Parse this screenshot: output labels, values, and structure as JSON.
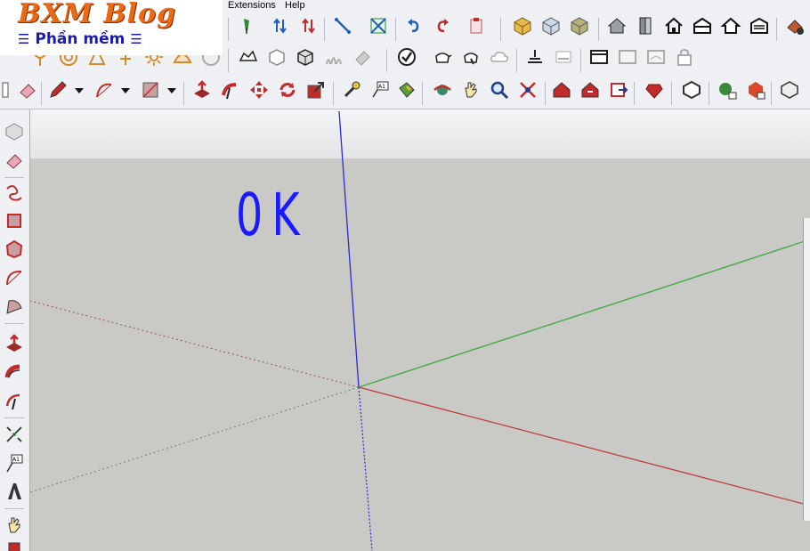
{
  "menu": {
    "items": [
      "Extensions",
      "Help"
    ]
  },
  "logo": {
    "title": "BXM Blog",
    "subtitle": "Phần mềm"
  },
  "viewport": {
    "handwritten_text": "0K"
  },
  "colors": {
    "axis_blue": "#2a2ad6",
    "axis_green": "#3caa3c",
    "axis_red": "#c33c3c",
    "ground": "#c9c9c6",
    "sky": "#eef0f0",
    "handwriting": "#1a1aff",
    "logo_orange": "#e96a12",
    "logo_blue": "#1b1db0"
  },
  "toolbar": {
    "row1": [
      "push-pin-icon",
      "flip-vertical-icon",
      "flip-horizontal-icon",
      "line-tool-icon",
      "scale-icon",
      "undo-icon",
      "redo-icon",
      "paste-icon",
      "box-yellow-icon",
      "box-blue-icon",
      "box-texture-icon",
      "house-icon",
      "door-icon",
      "home-icon",
      "warehouse-icon",
      "house-outline-icon",
      "garage-icon",
      "extension-settings-icon"
    ],
    "row2": [
      "sandbox-contour-icon",
      "from-scratch-icon",
      "target-icon",
      "cone-icon",
      "sun-icon",
      "dome-icon",
      "sphere-icon",
      "terrain-icon",
      "box-iso-icon",
      "box-shaded-icon",
      "grass-icon",
      "eraser-gray-icon",
      "check-icon",
      "teapot-icon",
      "hand-teapot-icon",
      "cloud-icon",
      "stamp-icon",
      "drape-icon",
      "window-icon",
      "section-fill-icon",
      "section-cut-icon",
      "lock-icon"
    ],
    "row3": [
      "select-icon",
      "eraser-icon",
      "pencil-icon",
      "arc-icon",
      "rectangle-icon",
      "push-pull-icon",
      "follow-me-icon",
      "move-icon",
      "rotate-icon",
      "scale-tool-icon",
      "tape-measure-icon",
      "text-icon",
      "paint-bucket-icon",
      "orbit-icon",
      "pan-icon",
      "zoom-icon",
      "zoom-extents-icon",
      "warehouse-red-icon",
      "share-icon",
      "export-icon",
      "ruby-icon",
      "outline-icon",
      "add-component-icon",
      "remove-component-icon",
      "shade-icon"
    ]
  },
  "left_toolbar": [
    "select-icon",
    "eraser-icon",
    "freehand-icon",
    "rectangle-icon",
    "polygon-icon",
    "arc-icon",
    "pie-icon",
    "push-pull-icon",
    "follow-me-icon",
    "offset-icon",
    "dimension-icon",
    "text-icon",
    "3d-text-icon",
    "pan-icon",
    "walk-icon"
  ]
}
